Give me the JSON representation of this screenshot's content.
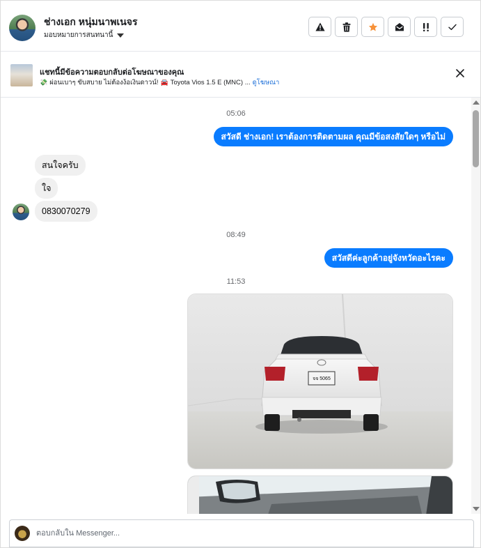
{
  "header": {
    "contact_name": "ช่างเอก หนุ่มนาพเนจร",
    "assign_label": "มอบหมายการสนทนานี้",
    "actions": [
      {
        "icon": "warning-icon",
        "label": "Spam"
      },
      {
        "icon": "trash-icon",
        "label": "Delete"
      },
      {
        "icon": "star-icon",
        "label": "Follow up",
        "color": "#f7923a"
      },
      {
        "icon": "envelope-open-icon",
        "label": "Mark as unread"
      },
      {
        "icon": "priority-icon",
        "label": "Priority"
      },
      {
        "icon": "check-icon",
        "label": "Done"
      }
    ]
  },
  "banner": {
    "title": "แชทนี้มีข้อความตอบกลับต่อโฆษณาของคุณ",
    "ad_text": "ผ่อนเบาๆ ขับสบาย ไม่ต้องง้อเงินดาวน์!",
    "car_text": "Toyota Vios 1.5 E (MNC) ...",
    "link_text": "ดูโฆษณา"
  },
  "conversation": {
    "ts1": "05:06",
    "out1": "สวัสดี ช่างเอก! เราต้องการติดตามผล คุณมีข้อสงสัยใดๆ หรือไม่",
    "in1": "สนใจครับ",
    "in2": "ใจ",
    "in3": "0830070279",
    "ts2": "08:49",
    "out2": "สวัสดีค่ะลูกค้าอยู่จังหวัดอะไรคะ",
    "ts3": "11:53",
    "plate_line1": "จจ 5065"
  },
  "reply": {
    "placeholder": "ตอบกลับใน Messenger..."
  },
  "colors": {
    "outgoing_bubble": "#0a7cff",
    "incoming_bubble": "#f0f0f0",
    "link": "#1a6ed8",
    "star": "#f7923a"
  }
}
